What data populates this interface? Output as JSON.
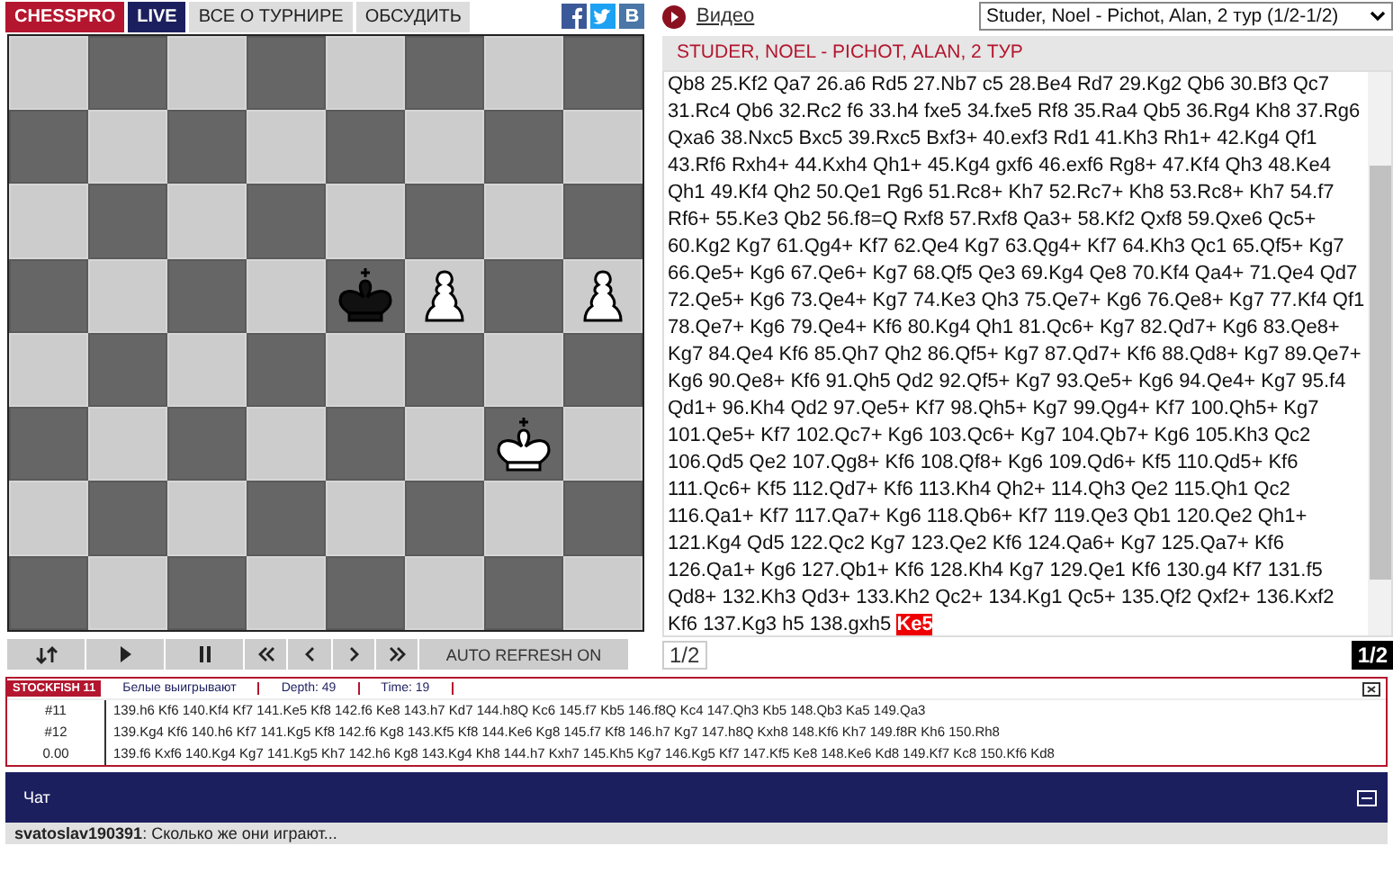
{
  "nav": {
    "tabs": [
      {
        "label": "CHESSPRO",
        "kind": "brand"
      },
      {
        "label": "LIVE",
        "kind": "live"
      },
      {
        "label": "ВСЕ О ТУРНИРЕ",
        "kind": "plain"
      },
      {
        "label": "ОБСУДИТЬ",
        "kind": "plain"
      }
    ]
  },
  "video_link": "Видео",
  "game_select": {
    "value": "Studer, Noel - Pichot, Alan, 2 тур (1/2-1/2)"
  },
  "game_title": "STUDER, NOEL - PICHOT, ALAN, 2 ТУР",
  "board": {
    "rows": [
      [
        {
          "kind": "empty"
        },
        {
          "kind": "empty"
        },
        {
          "kind": "empty"
        },
        {
          "kind": "empty"
        },
        {
          "kind": "empty"
        },
        {
          "kind": "empty"
        },
        {
          "kind": "empty"
        },
        {
          "kind": "empty"
        }
      ],
      [
        {
          "kind": "empty"
        },
        {
          "kind": "empty"
        },
        {
          "kind": "empty"
        },
        {
          "kind": "empty"
        },
        {
          "kind": "empty"
        },
        {
          "kind": "empty"
        },
        {
          "kind": "empty"
        },
        {
          "kind": "empty"
        }
      ],
      [
        {
          "kind": "empty"
        },
        {
          "kind": "empty"
        },
        {
          "kind": "empty"
        },
        {
          "kind": "empty"
        },
        {
          "kind": "empty"
        },
        {
          "kind": "empty"
        },
        {
          "kind": "empty"
        },
        {
          "kind": "empty"
        }
      ],
      [
        {
          "kind": "empty"
        },
        {
          "kind": "empty"
        },
        {
          "kind": "empty"
        },
        {
          "kind": "empty"
        },
        {
          "kind": "black_king"
        },
        {
          "kind": "white_pawn"
        },
        {
          "kind": "empty"
        },
        {
          "kind": "white_pawn"
        }
      ],
      [
        {
          "kind": "empty"
        },
        {
          "kind": "empty"
        },
        {
          "kind": "empty"
        },
        {
          "kind": "empty"
        },
        {
          "kind": "empty"
        },
        {
          "kind": "empty"
        },
        {
          "kind": "empty"
        },
        {
          "kind": "empty"
        }
      ],
      [
        {
          "kind": "empty"
        },
        {
          "kind": "empty"
        },
        {
          "kind": "empty"
        },
        {
          "kind": "empty"
        },
        {
          "kind": "empty"
        },
        {
          "kind": "empty"
        },
        {
          "kind": "white_king"
        },
        {
          "kind": "empty"
        }
      ],
      [
        {
          "kind": "empty"
        },
        {
          "kind": "empty"
        },
        {
          "kind": "empty"
        },
        {
          "kind": "empty"
        },
        {
          "kind": "empty"
        },
        {
          "kind": "empty"
        },
        {
          "kind": "empty"
        },
        {
          "kind": "empty"
        }
      ],
      [
        {
          "kind": "empty"
        },
        {
          "kind": "empty"
        },
        {
          "kind": "empty"
        },
        {
          "kind": "empty"
        },
        {
          "kind": "empty"
        },
        {
          "kind": "empty"
        },
        {
          "kind": "empty"
        },
        {
          "kind": "empty"
        }
      ]
    ]
  },
  "controls": [
    {
      "kind": "flip"
    },
    {
      "kind": "play"
    },
    {
      "kind": "pause"
    },
    {
      "kind": "first"
    },
    {
      "kind": "prev"
    },
    {
      "kind": "next"
    },
    {
      "kind": "last"
    },
    {
      "kind": "text",
      "label": "AUTO REFRESH ON"
    }
  ],
  "moves": {
    "text": "Qb8 25.Kf2 Qa7 26.a6 Rd5 27.Nb7 c5 28.Be4 Rd7 29.Kg2 Qb6 30.Bf3 Qc7 31.Rc4 Qb6 32.Rc2 f6 33.h4 fxe5 34.fxe5 Rf8 35.Ra4 Qb5 36.Rg4 Kh8 37.Rg6 Qxa6 38.Nxc5 Bxc5 39.Rxc5 Bxf3+ 40.exf3 Rd1 41.Kh3 Rh1+ 42.Kg4 Qf1 43.Rf6 Rxh4+ 44.Kxh4 Qh1+ 45.Kg4 gxf6 46.exf6 Rg8+ 47.Kf4 Qh3 48.Ke4 Qh1 49.Kf4 Qh2 50.Qe1 Rg6 51.Rc8+ Kh7 52.Rc7+ Kh8 53.Rc8+ Kh7 54.f7 Rf6+ 55.Ke3 Qb2 56.f8=Q Rxf8 57.Rxf8 Qa3+ 58.Kf2 Qxf8 59.Qxe6 Qc5+ 60.Kg2 Kg7 61.Qg4+ Kf7 62.Qe4 Kg7 63.Qg4+ Kf7 64.Kh3 Qc1 65.Qf5+ Kg7 66.Qe5+ Kg6 67.Qe6+ Kg7 68.Qf5 Qe3 69.Kg4 Qe8 70.Kf4 Qa4+ 71.Qe4 Qd7 72.Qe5+ Kg6 73.Qe4+ Kg7 74.Ke3 Qh3 75.Qe7+ Kg6 76.Qe8+ Kg7 77.Kf4 Qf1 78.Qe7+ Kg6 79.Qe4+ Kf6 80.Kg4 Qh1 81.Qc6+ Kg7 82.Qd7+ Kg6 83.Qe8+ Kg7 84.Qe4 Kf6 85.Qh7 Qh2 86.Qf5+ Kg7 87.Qd7+ Kf6 88.Qd8+ Kg7 89.Qe7+ Kg6 90.Qe8+ Kf6 91.Qh5 Qd2 92.Qf5+ Kg7 93.Qe5+ Kg6 94.Qe4+ Kg7 95.f4 Qd1+ 96.Kh4 Qd2 97.Qe5+ Kf7 98.Qh5+ Kg7 99.Qg4+ Kf7 100.Qh5+ Kg7 101.Qe5+ Kf7 102.Qc7+ Kg6 103.Qc6+ Kg7 104.Qb7+ Kg6 105.Kh3 Qc2 106.Qd5 Qe2 107.Qg8+ Kf6 108.Qf8+ Kg6 109.Qd6+ Kf5 110.Qd5+ Kf6 111.Qc6+ Kf5 112.Qd7+ Kf6 113.Kh4 Qh2+ 114.Qh3 Qe2 115.Qh1 Qc2 116.Qa1+ Kf7 117.Qa7+ Kg6 118.Qb6+ Kf7 119.Qe3 Qb1 120.Qe2 Qh1+ 121.Kg4 Qd5 122.Qc2 Kg7 123.Qe2 Kf6 124.Qa6+ Kg7 125.Qa7+ Kf6 126.Qa1+ Kg6 127.Qb1+ Kf6 128.Kh4 Kg7 129.Qe1 Kf6 130.g4 Kf7 131.f5 Qd8+ 132.Kh3 Qd3+ 133.Kh2 Qc2+ 134.Kg1 Qc5+ 135.Qf2 Qxf2+ 136.Kxf2 Kf6 137.Kg3 h5 138.gxh5",
    "current_move": "Ke5"
  },
  "result_box": "1/2",
  "result_badge": "1/2",
  "engine": {
    "name": "STOCKFISH 11",
    "tabs": [
      "Белые выигрывают",
      "Depth: 49",
      "Time: 19"
    ],
    "lines": [
      {
        "score": "#11",
        "moves": "139.h6 Kf6 140.Kf4 Kf7 141.Ke5 Kf8 142.f6 Ke8 143.h7 Kd7 144.h8Q Kc6 145.f7 Kb5 146.f8Q Kc4 147.Qh3 Kb5 148.Qb3 Ka5 149.Qa3"
      },
      {
        "score": "#12",
        "moves": "139.Kg4 Kf6 140.h6 Kf7 141.Kg5 Kf8 142.f6 Kg8 143.Kf5 Kf8 144.Ke6 Kg8 145.f7 Kf8 146.h7 Kg7 147.h8Q Kxh8 148.Kf6 Kh7 149.f8R Kh6 150.Rh8"
      },
      {
        "score": "0.00",
        "moves": "139.f6 Kxf6 140.Kg4 Kg7 141.Kg5 Kh7 142.h6 Kg8 143.Kg4 Kh8 144.h7 Kxh7 145.Kh5 Kg7 146.Kg5 Kf7 147.Kf5 Ke8 148.Ke6 Kd8 149.Kf7 Kc8 150.Kf6 Kd8"
      }
    ]
  },
  "chat": {
    "title": "Чат",
    "messages": [
      "**svatoslav190391**: Сколько же они играют..."
    ]
  }
}
